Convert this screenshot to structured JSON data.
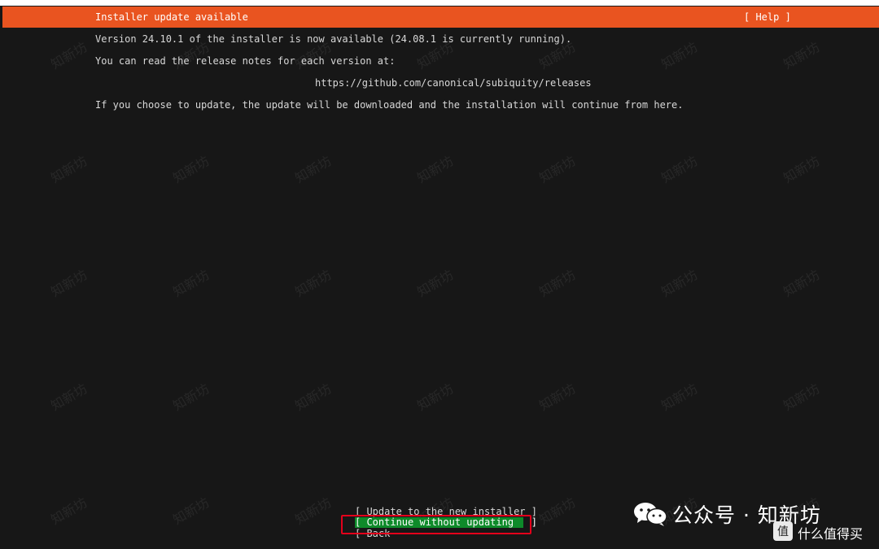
{
  "header": {
    "title": "Installer update available",
    "help_label": "[ Help ]"
  },
  "body": {
    "version_line": "Version 24.10.1 of the installer is now available (24.08.1 is currently running).",
    "notes_line": "You can read the release notes for each version at:",
    "release_url": "https://github.com/canonical/subiquity/releases",
    "update_line": "If you choose to update, the update will be downloaded and the installation will continue from here."
  },
  "buttons": {
    "update_label": "[ Update to the new installer ]",
    "continue_label": "[ Continue without updating   ]",
    "back_label": "[ Back"
  },
  "watermark": {
    "text": "知新坊"
  },
  "brand": {
    "text": "公众号 · 知新坊",
    "corner_text": "什么值得买",
    "corner_badge": "值"
  },
  "colors": {
    "header_orange": "#e95420",
    "selected_green": "#0e8a2a",
    "highlight_red": "#e3001b",
    "background": "#171717"
  },
  "icons": {
    "brand_icon": "wechat-icon"
  }
}
